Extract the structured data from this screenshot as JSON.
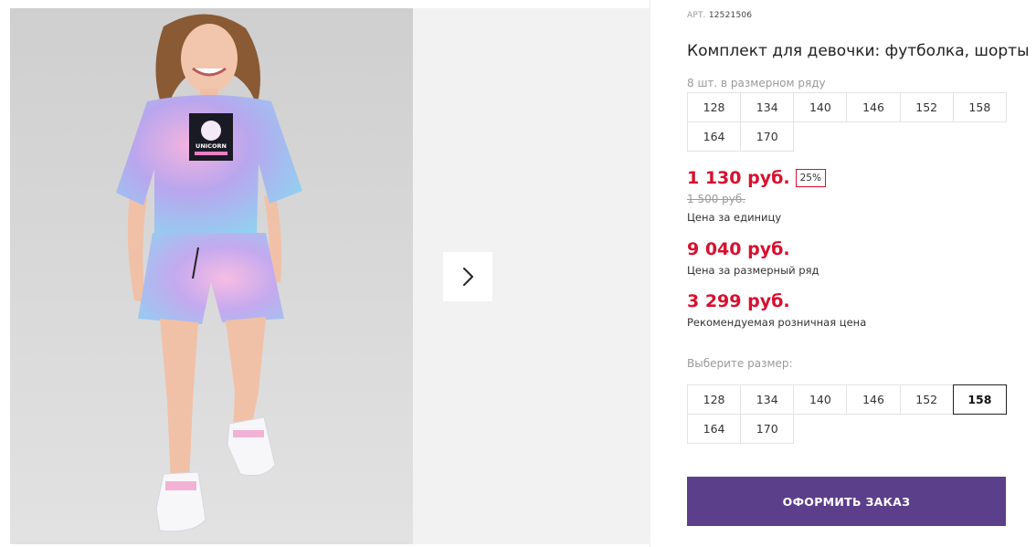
{
  "product": {
    "art_label": "АРТ.",
    "art_number": "12521506",
    "title": "Комплект для девочки: футболка, шорты",
    "pack_label": "8 шт. в размерном ряду",
    "pack_sizes": [
      "128",
      "134",
      "140",
      "146",
      "152",
      "158",
      "164",
      "170"
    ]
  },
  "pricing": {
    "unit_price": "1 130 руб.",
    "discount_badge": "25%",
    "old_price": "1 500 руб.",
    "unit_label": "Цена за единицу",
    "row_price": "9 040 руб.",
    "row_label": "Цена за размерный ряд",
    "retail_price": "3 299 руб.",
    "retail_label": "Рекомендуемая розничная цена"
  },
  "size_picker": {
    "label": "Выберите размер:",
    "sizes": [
      "128",
      "134",
      "140",
      "146",
      "152",
      "158",
      "164",
      "170"
    ],
    "selected": "158"
  },
  "actions": {
    "order_label": "ОФОРМИТЬ ЗАКАЗ"
  },
  "gallery": {
    "print_text": "UNICORN",
    "next_icon": "chevron-right-icon"
  },
  "colors": {
    "price_red": "#d8102e",
    "button_purple": "#5c3f8b"
  }
}
